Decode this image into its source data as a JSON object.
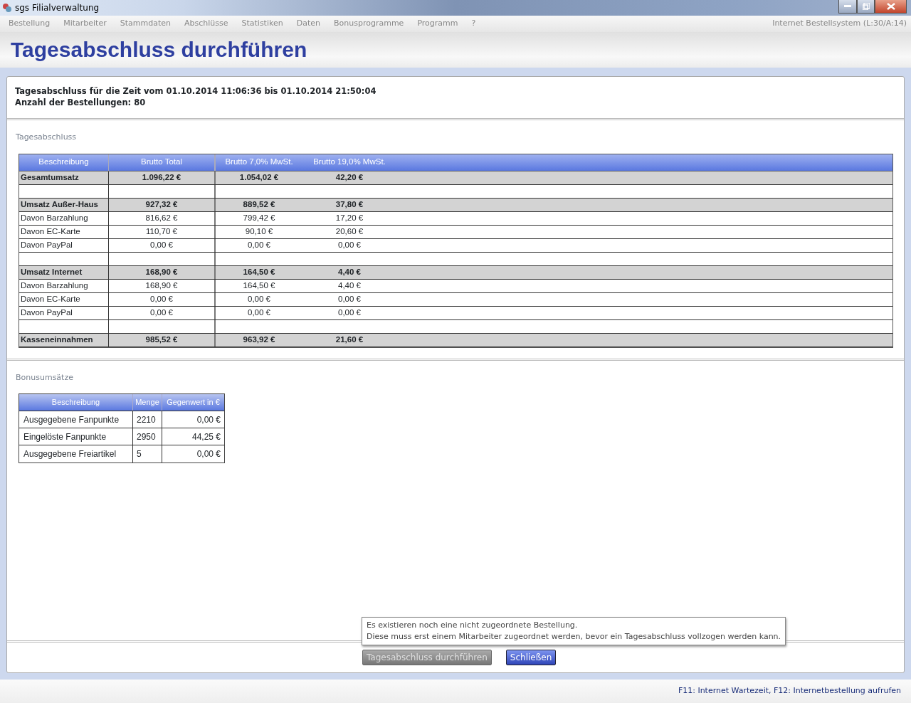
{
  "window": {
    "title": "sgs Filialverwaltung"
  },
  "menu": {
    "items": [
      "Bestellung",
      "Mitarbeiter",
      "Stammdaten",
      "Abschlüsse",
      "Statistiken",
      "Daten",
      "Bonusprogramme",
      "Programm",
      "?"
    ],
    "right_text": "Internet Bestellsystem (L:30/A:14)"
  },
  "page_title": "Tagesabschluss durchführen",
  "info": [
    "Tagesabschluss für die Zeit vom 01.10.2014 11:06:36 bis 01.10.2014 21:50:04",
    "Anzahl der Bestellungen: 80"
  ],
  "summary": {
    "label": "Tagesabschluss",
    "columns": [
      "Beschreibung",
      "Brutto Total",
      "Brutto 7,0% MwSt.",
      "Brutto 19,0% MwSt."
    ],
    "rows": [
      {
        "kind": "total",
        "cells": [
          "Gesamtumsatz",
          "1.096,22 €",
          "1.054,02 €",
          "42,20 €"
        ]
      },
      {
        "kind": "spacer"
      },
      {
        "kind": "total",
        "cells": [
          "Umsatz Außer-Haus",
          "927,32 €",
          "889,52 €",
          "37,80 €"
        ]
      },
      {
        "kind": "detail",
        "cells": [
          "Davon Barzahlung",
          "816,62 €",
          "799,42 €",
          "17,20 €"
        ]
      },
      {
        "kind": "detail",
        "cells": [
          "Davon EC-Karte",
          "110,70 €",
          "90,10 €",
          "20,60 €"
        ]
      },
      {
        "kind": "detail",
        "cells": [
          "Davon PayPal",
          "0,00 €",
          "0,00 €",
          "0,00 €"
        ]
      },
      {
        "kind": "spacer"
      },
      {
        "kind": "total",
        "cells": [
          "Umsatz Internet",
          "168,90 €",
          "164,50 €",
          "4,40 €"
        ]
      },
      {
        "kind": "detail",
        "cells": [
          "Davon Barzahlung",
          "168,90 €",
          "164,50 €",
          "4,40 €"
        ]
      },
      {
        "kind": "detail",
        "cells": [
          "Davon EC-Karte",
          "0,00 €",
          "0,00 €",
          "0,00 €"
        ]
      },
      {
        "kind": "detail",
        "cells": [
          "Davon PayPal",
          "0,00 €",
          "0,00 €",
          "0,00 €"
        ]
      },
      {
        "kind": "spacer"
      },
      {
        "kind": "total",
        "cells": [
          "Kasseneinnahmen",
          "985,52 €",
          "963,92 €",
          "21,60 €"
        ]
      }
    ]
  },
  "bonus": {
    "label": "Bonusumsätze",
    "columns": [
      "Beschreibung",
      "Menge",
      "Gegenwert in €"
    ],
    "rows": [
      {
        "cells": [
          "Ausgegebene Fanpunkte",
          "2210",
          "0,00 €"
        ]
      },
      {
        "cells": [
          "Eingelöste Fanpunkte",
          "2950",
          "44,25 €"
        ]
      },
      {
        "cells": [
          "Ausgegebene Freiartikel",
          "5",
          "0,00 €"
        ]
      }
    ]
  },
  "tooltip": [
    "Es existieren noch eine nicht zugeordnete Bestellung.",
    "Diese muss erst einem Mitarbeiter zugeordnet werden, bevor ein Tagesabschluss vollzogen werden kann."
  ],
  "buttons": [
    {
      "label": "Tagesabschluss durchführen",
      "disabled": true
    },
    {
      "label": "Schließen",
      "disabled": false
    }
  ],
  "status_bar": "F11: Internet Wartezeit, F12: Internetbestellung aufrufen"
}
